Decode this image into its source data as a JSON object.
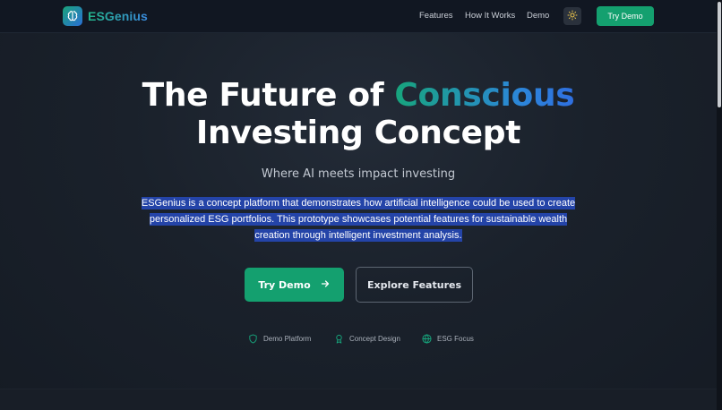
{
  "brand": {
    "name": "ESGenius"
  },
  "nav": {
    "features": "Features",
    "how_it_works": "How It Works",
    "demo": "Demo",
    "try_demo": "Try Demo"
  },
  "hero": {
    "title_part1": "The Future of ",
    "title_accent": "Conscious",
    "title_line2": "Investing Concept",
    "tagline": "Where AI meets impact investing",
    "description": "ESGenius is a concept platform that demonstrates how artificial intelligence could be used to create personalized ESG portfolios. This prototype showcases potential features for sustainable wealth creation through intelligent investment analysis.",
    "primary_button": "Try Demo",
    "secondary_button": "Explore Features"
  },
  "features": [
    {
      "label": "Demo Platform",
      "icon": "shield-icon"
    },
    {
      "label": "Concept Design",
      "icon": "award-icon"
    },
    {
      "label": "ESG Focus",
      "icon": "globe-icon"
    }
  ],
  "colors": {
    "accent_green": "#14a06f",
    "accent_blue": "#2c86d9",
    "selection": "#2444a8",
    "background": "#1a212b"
  }
}
